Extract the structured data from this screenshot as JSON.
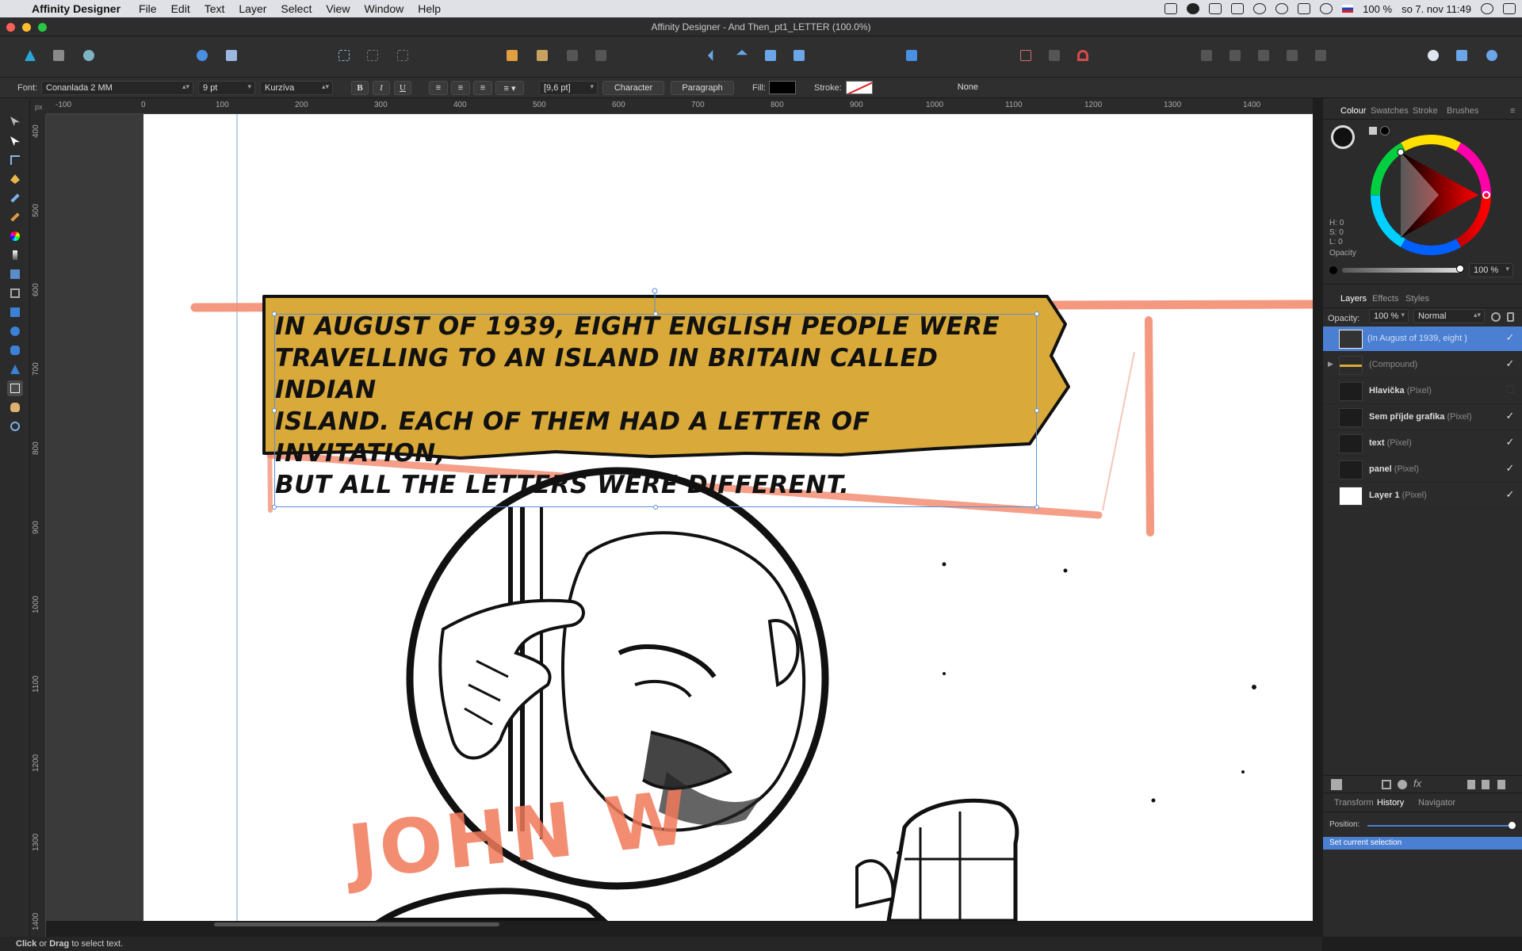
{
  "menubar": {
    "app_name": "Affinity Designer",
    "items": [
      "File",
      "Edit",
      "Text",
      "Layer",
      "Select",
      "View",
      "Window",
      "Help"
    ],
    "battery": "100 %",
    "datetime": "so 7. nov  11:49"
  },
  "window": {
    "title": "Affinity Designer - And Then_pt1_LETTER (100.0%)"
  },
  "context_toolbar": {
    "font_label": "Font:",
    "font_family": "Conanlada 2 MM",
    "font_size": "9 pt",
    "font_style": "Kurzíva",
    "bold": "B",
    "italic": "I",
    "underline": "U",
    "leading": "[9,6 pt]",
    "character_btn": "Character",
    "paragraph_btn": "Paragraph",
    "fill_label": "Fill:",
    "stroke_label": "Stroke:",
    "stroke_value": "None"
  },
  "ruler": {
    "unit": "px",
    "top_ticks": [
      "-100",
      "0",
      "100",
      "200",
      "300",
      "400",
      "500",
      "600",
      "700",
      "800",
      "900",
      "1000",
      "1100",
      "1200",
      "1300",
      "1400"
    ],
    "left_ticks": [
      "400",
      "500",
      "600",
      "700",
      "800",
      "900",
      "1000",
      "1100",
      "1200",
      "1300",
      "1400"
    ]
  },
  "canvas": {
    "caption_lines": [
      "In August of 1939, eight English people were",
      "travelling to an island in Britain called Indian",
      "Island. Each of them had a letter of invitation,",
      "but all the letters were different."
    ],
    "sketch_text": "JOHN W"
  },
  "colour_panel": {
    "tabs": [
      "Colour",
      "Swatches",
      "Stroke",
      "Brushes"
    ],
    "h": "H: 0",
    "s": "S: 0",
    "l": "L: 0",
    "opacity_label": "Opacity",
    "opacity_value": "100 %",
    "hue_ring": "#ff0000"
  },
  "layers_panel": {
    "tabs": [
      "Layers",
      "Effects",
      "Styles"
    ],
    "opacity_label": "Opacity:",
    "opacity_value": "100 %",
    "blend_mode": "Normal",
    "layers": [
      {
        "name": "",
        "kind": "(In August of 1939, eight )",
        "visible": true,
        "selected": true
      },
      {
        "name": "",
        "kind": "(Compound)",
        "visible": true,
        "selected": false
      },
      {
        "name": "Hlavička",
        "kind": "(Pixel)",
        "visible": false,
        "selected": false
      },
      {
        "name": "Sem příjde grafika",
        "kind": "(Pixel)",
        "visible": true,
        "selected": false
      },
      {
        "name": "text",
        "kind": "(Pixel)",
        "visible": true,
        "selected": false
      },
      {
        "name": "panel",
        "kind": "(Pixel)",
        "visible": true,
        "selected": false
      },
      {
        "name": "Layer 1",
        "kind": "(Pixel)",
        "visible": true,
        "selected": false
      }
    ]
  },
  "history_panel": {
    "tabs": [
      "Transform",
      "History",
      "Navigator"
    ],
    "position_label": "Position:",
    "entry": "Set current selection"
  },
  "status": {
    "click": "Click",
    "or": " or ",
    "drag": "Drag",
    "rest": " to select text."
  },
  "colors": {
    "caption_box": "#d9a93a",
    "sketch_red": "#f07a5a",
    "selection_blue": "#5c8fd6",
    "layer_selected": "#4a7fd1"
  }
}
